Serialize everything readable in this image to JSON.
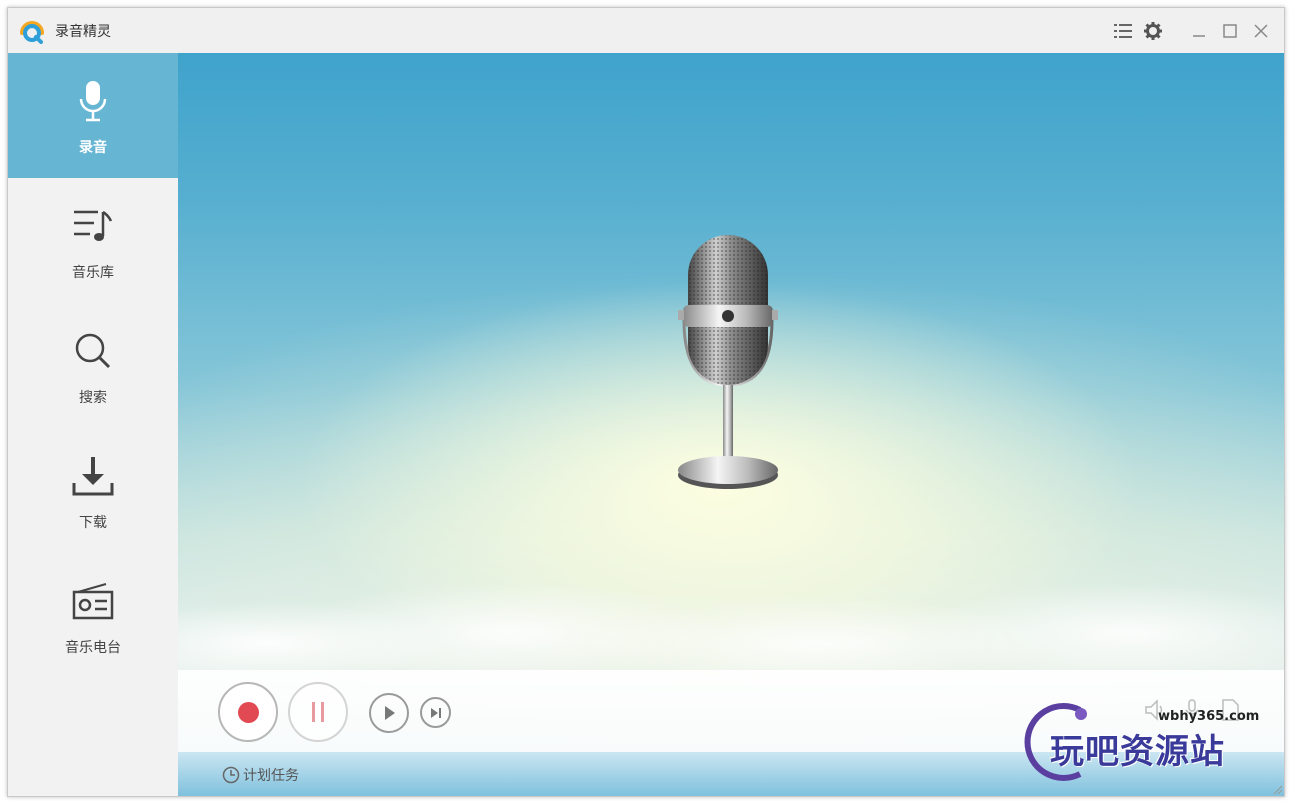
{
  "app": {
    "title": "录音精灵"
  },
  "titlebar": {
    "icons": [
      "menu-icon",
      "gear-icon",
      "minimize-icon",
      "maximize-icon",
      "close-icon"
    ]
  },
  "sidebar": {
    "items": [
      {
        "label": "录音",
        "icon": "microphone-icon",
        "active": true
      },
      {
        "label": "音乐库",
        "icon": "music-list-icon",
        "active": false
      },
      {
        "label": "搜索",
        "icon": "search-icon",
        "active": false
      },
      {
        "label": "下载",
        "icon": "download-icon",
        "active": false
      },
      {
        "label": "音乐电台",
        "icon": "radio-icon",
        "active": false
      }
    ]
  },
  "player": {
    "controls": [
      "record-icon",
      "pause-icon",
      "play-icon",
      "next-icon"
    ],
    "right_icons": [
      "volume-icon",
      "input-source-icon",
      "file-icon"
    ]
  },
  "bottom": {
    "schedule_label": "计划任务"
  },
  "watermark": {
    "site": "wbhy365.com",
    "text": "玩吧资源站"
  },
  "colors": {
    "accent": "#66b6d3",
    "record": "#e24a53",
    "pause": "#e89aa0"
  }
}
